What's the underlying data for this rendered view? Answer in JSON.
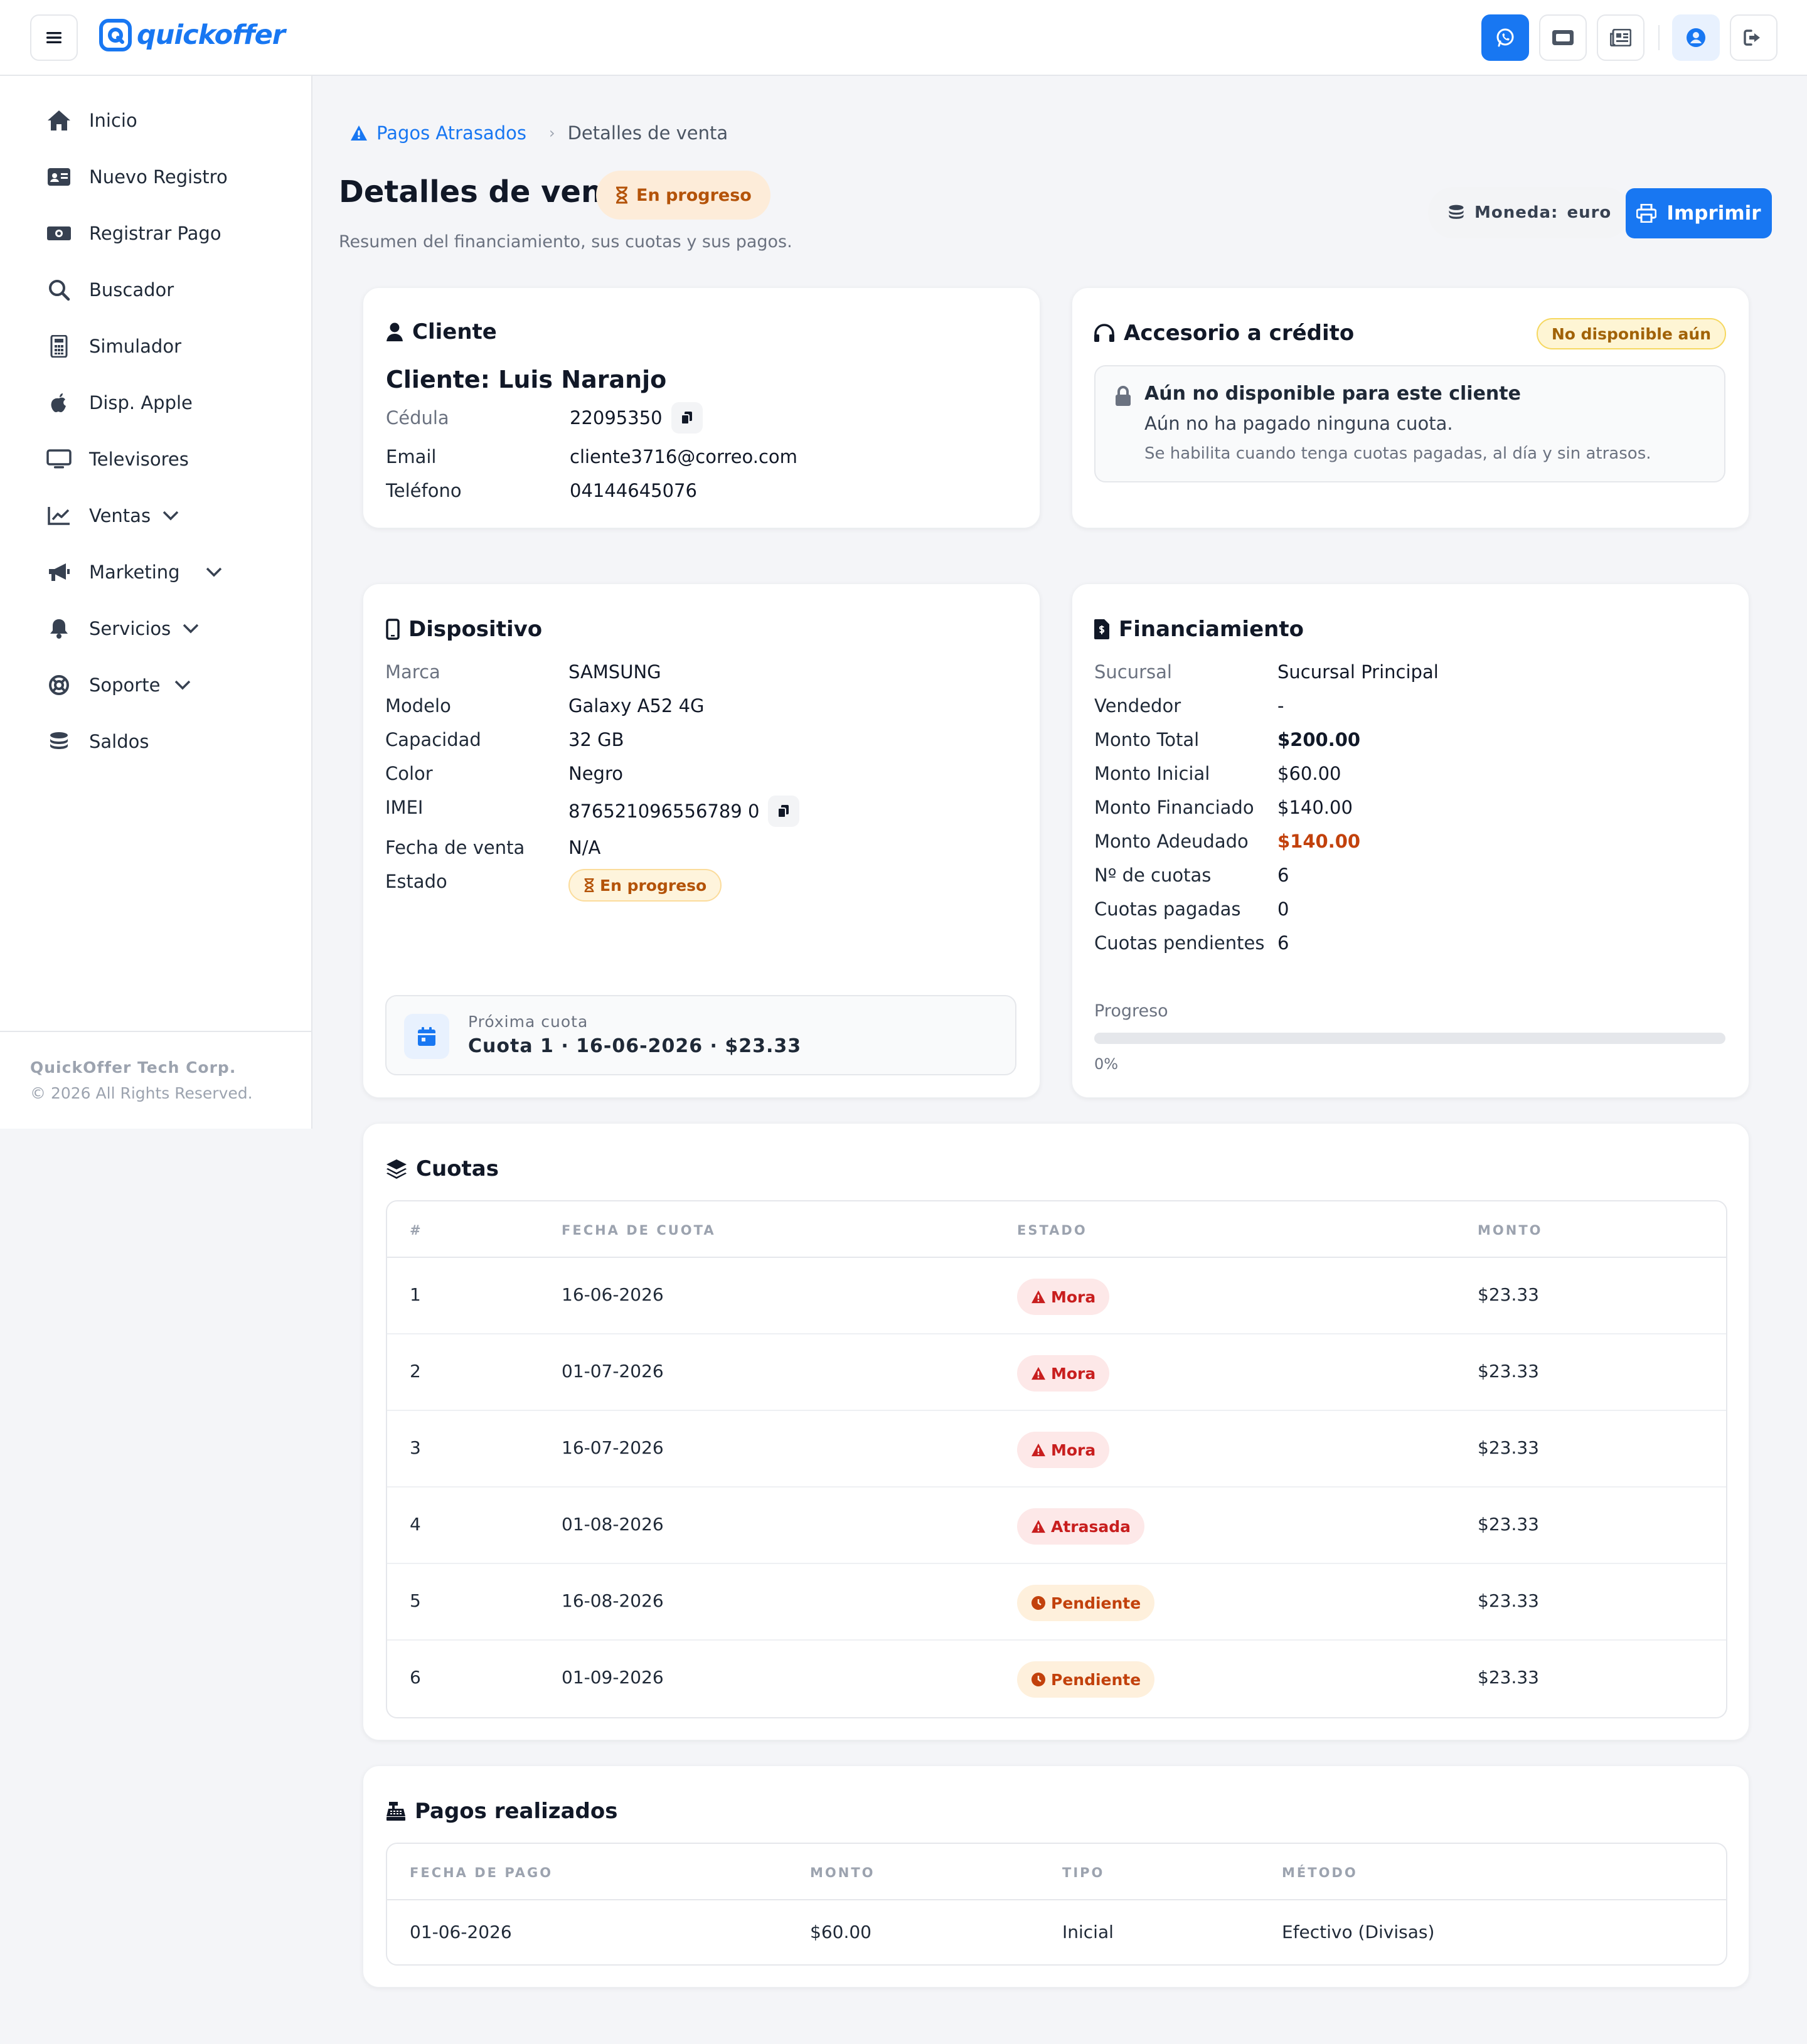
{
  "brand": {
    "name": "quickoffer",
    "primary": "#1877f2"
  },
  "header": {
    "icons": [
      "whatsapp-icon",
      "ticket-icon",
      "newspaper-icon",
      "user-circle-icon",
      "logout-icon"
    ]
  },
  "sidebar": {
    "items": [
      {
        "label": "Inicio",
        "icon": "home-icon"
      },
      {
        "label": "Nuevo Registro",
        "icon": "id-card-icon"
      },
      {
        "label": "Registrar Pago",
        "icon": "money-icon"
      },
      {
        "label": "Buscador",
        "icon": "search-icon"
      },
      {
        "label": "Simulador",
        "icon": "calculator-icon"
      },
      {
        "label": "Disp. Apple",
        "icon": "apple-icon"
      },
      {
        "label": "Televisores",
        "icon": "tv-icon"
      },
      {
        "label": "Ventas",
        "icon": "chart-line-icon",
        "expandable": true
      },
      {
        "label": "Marketing",
        "icon": "megaphone-icon",
        "expandable": true
      },
      {
        "label": "Servicios",
        "icon": "bell-icon",
        "expandable": true
      },
      {
        "label": "Soporte",
        "icon": "lifebuoy-icon",
        "expandable": true
      },
      {
        "label": "Saldos",
        "icon": "coins-icon"
      }
    ],
    "footer": {
      "company": "QuickOffer Tech Corp.",
      "rights": "© 2026 All Rights Reserved."
    }
  },
  "breadcrumb": {
    "parent": "Pagos Atrasados",
    "current": "Detalles de venta"
  },
  "page": {
    "title": "Detalles de venta",
    "status": "En progreso",
    "subtitle": "Resumen del financiamiento, sus cuotas y sus pagos.",
    "currency_label": "Moneda:",
    "currency_value": "euro",
    "print_label": "Imprimir"
  },
  "client": {
    "section_title": "Cliente",
    "heading": "Cliente: Luis Naranjo",
    "fields": [
      {
        "label": "Cédula",
        "value": "22095350"
      },
      {
        "label": "Email",
        "value": "cliente3716@correo.com"
      },
      {
        "label": "Teléfono",
        "value": "04144645076"
      }
    ]
  },
  "credit": {
    "section_title": "Accesorio a crédito",
    "badge": "No disponible aún",
    "notice_title": "Aún no disponible para este cliente",
    "notice_line1": "Aún no ha pagado ninguna cuota.",
    "notice_line2": "Se habilita cuando tenga cuotas pagadas, al día y sin atrasos."
  },
  "device": {
    "section_title": "Dispositivo",
    "fields": [
      {
        "label": "Marca",
        "value": "SAMSUNG"
      },
      {
        "label": "Modelo",
        "value": "Galaxy A52 4G"
      },
      {
        "label": "Capacidad",
        "value": "32 GB"
      },
      {
        "label": "Color",
        "value": "Negro"
      },
      {
        "label": "IMEI",
        "value": "876521096556789 0"
      },
      {
        "label": "Fecha de venta",
        "value": "N/A"
      },
      {
        "label": "Estado",
        "value": "En progreso"
      }
    ],
    "next_label": "Próxima cuota",
    "next_value": "Cuota 1 · 16-06-2026 · $23.33"
  },
  "financing": {
    "section_title": "Financiamiento",
    "fields": [
      {
        "label": "Sucursal",
        "value": "Sucursal Principal"
      },
      {
        "label": "Vendedor",
        "value": "-"
      },
      {
        "label": "Monto Total",
        "value": "$200.00"
      },
      {
        "label": "Monto Inicial",
        "value": "$60.00"
      },
      {
        "label": "Monto Financiado",
        "value": "$140.00"
      },
      {
        "label": "Monto Adeudado",
        "value": "$140.00"
      },
      {
        "label": "Nº de cuotas",
        "value": "6"
      },
      {
        "label": "Cuotas pagadas",
        "value": "0"
      },
      {
        "label": "Cuotas pendientes",
        "value": "6"
      }
    ],
    "progress_label": "Progreso",
    "progress_value": "0%",
    "progress_fraction": 0,
    "owed_color": "#c2410c"
  },
  "installments": {
    "section_title": "Cuotas",
    "headers": [
      "#",
      "FECHA DE CUOTA",
      "ESTADO",
      "MONTO"
    ],
    "rows": [
      {
        "n": "1",
        "date": "16-06-2026",
        "status": "Mora",
        "kind": "mora",
        "amount": "$23.33"
      },
      {
        "n": "2",
        "date": "01-07-2026",
        "status": "Mora",
        "kind": "mora",
        "amount": "$23.33"
      },
      {
        "n": "3",
        "date": "16-07-2026",
        "status": "Mora",
        "kind": "mora",
        "amount": "$23.33"
      },
      {
        "n": "4",
        "date": "01-08-2026",
        "status": "Atrasada",
        "kind": "mora",
        "amount": "$23.33"
      },
      {
        "n": "5",
        "date": "16-08-2026",
        "status": "Pendiente",
        "kind": "pend",
        "amount": "$23.33"
      },
      {
        "n": "6",
        "date": "01-09-2026",
        "status": "Pendiente",
        "kind": "pend",
        "amount": "$23.33"
      }
    ]
  },
  "payments": {
    "section_title": "Pagos realizados",
    "headers": [
      "FECHA DE PAGO",
      "MONTO",
      "TIPO",
      "MÉTODO"
    ],
    "rows": [
      {
        "date": "01-06-2026",
        "amount": "$60.00",
        "type": "Inicial",
        "method": "Efectivo (Divisas)"
      }
    ]
  }
}
